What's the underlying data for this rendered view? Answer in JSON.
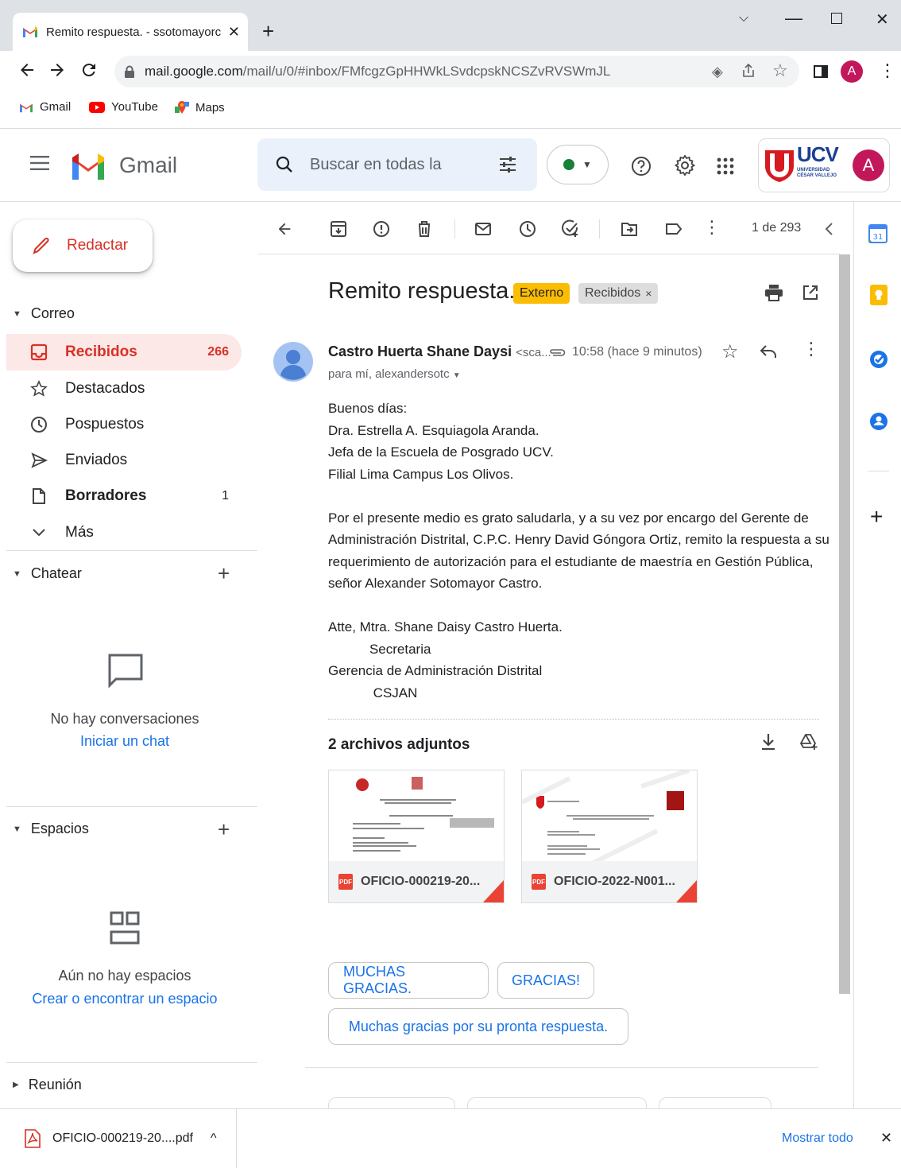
{
  "browser": {
    "tab_title": "Remito respuesta. - ssotomayorc",
    "url_host": "mail.google.com",
    "url_path": "/mail/u/0/#inbox/FMfcgzGpHHWkLSvdcpskNCSZvRVSWmJL",
    "profile_initial": "A",
    "bookmarks": [
      "Gmail",
      "YouTube",
      "Maps"
    ]
  },
  "gmail": {
    "logo_text": "Gmail",
    "search_placeholder": "Buscar en todas la",
    "org_name": "UCV",
    "org_sub": "UNIVERSIDAD CÉSAR VALLEJO",
    "account_initial": "A",
    "compose_label": "Redactar",
    "sections": {
      "mail": "Correo",
      "chat": "Chatear",
      "spaces": "Espacios",
      "meet": "Reunión"
    },
    "nav": [
      {
        "label": "Recibidos",
        "count": "266"
      },
      {
        "label": "Destacados",
        "count": ""
      },
      {
        "label": "Pospuestos",
        "count": ""
      },
      {
        "label": "Enviados",
        "count": ""
      },
      {
        "label": "Borradores",
        "count": "1"
      },
      {
        "label": "Más",
        "count": ""
      }
    ],
    "chat_empty": "No hay conversaciones",
    "chat_link": "Iniciar un chat",
    "spaces_empty": "Aún no hay espacios",
    "spaces_link": "Crear o encontrar un espacio",
    "pagination": "1 de 293"
  },
  "email": {
    "subject": "Remito respuesta.",
    "label_external": "Externo",
    "label_inbox": "Recibidos",
    "sender_name": "Castro Huerta Shane Daysi",
    "sender_email": "<sca...",
    "time": "10:58 (hace 9 minutos)",
    "recipients": "para mí, alexandersotc",
    "body_lines": [
      "Buenos días:",
      "Dra. Estrella A. Esquiagola Aranda.",
      "Jefa de la Escuela de Posgrado UCV.",
      "Filial Lima Campus Los Olivos.",
      "",
      "Por el presente medio es grato saludarla, y a su vez por encargo del Gerente de",
      "Administración Distrital, C.P.C. Henry David Góngora Ortiz, remito la respuesta a su",
      "requerimiento de autorización para el estudiante de maestría en Gestión Pública,",
      "señor Alexander Sotomayor Castro.",
      "",
      "Atte, Mtra. Shane Daisy Castro Huerta.",
      "           Secretaria",
      "Gerencia de Administración Distrital",
      "            CSJAN"
    ],
    "attachments_title": "2 archivos adjuntos",
    "attachments": [
      {
        "name": "OFICIO-000219-20...",
        "badge": "PDF"
      },
      {
        "name": "OFICIO-2022-N001...",
        "badge": "PDF"
      }
    ],
    "smart_replies": [
      "MUCHAS GRACIAS.",
      "GRACIAS!",
      "Muchas gracias por su pronta respuesta."
    ]
  },
  "download_bar": {
    "file": "OFICIO-000219-20....pdf",
    "show_all": "Mostrar todo"
  }
}
